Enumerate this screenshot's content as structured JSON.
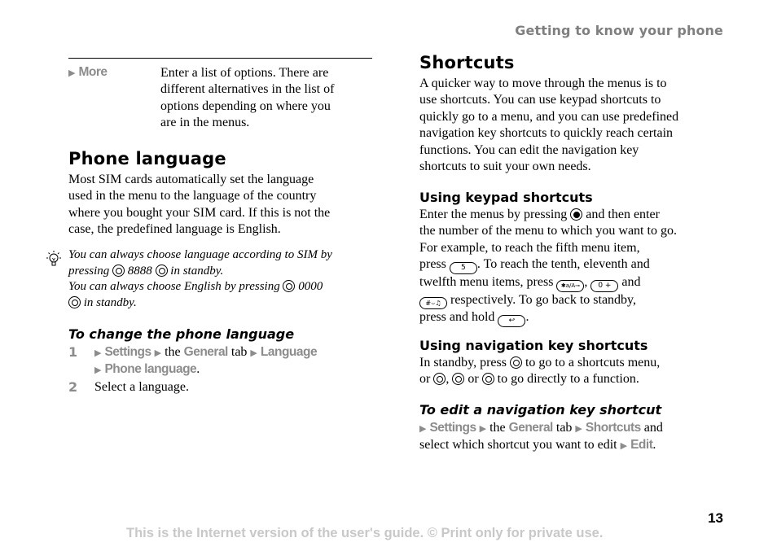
{
  "header": {
    "running_title": "Getting to know your phone"
  },
  "left": {
    "more_row": {
      "label": "More",
      "description_lines": [
        "Enter a list of options. There are",
        "different alternatives in the list of",
        "options depending on where you",
        "are in the menus."
      ]
    },
    "phone_language": {
      "title": "Phone language",
      "body_lines": [
        "Most SIM cards automatically set the language",
        "used in the menu to the language of the country",
        "where you bought your SIM card. If this is not the",
        "case, the predefined language is English."
      ]
    },
    "tip": {
      "icon": "lightbulb-icon",
      "line1": "You can always choose language according to SIM by",
      "line2_a": "pressing",
      "line2_code": "8888",
      "line2_b": "in standby.",
      "line3_a": "You can always choose English by pressing",
      "line3_code": "0000",
      "line4_b": "in standby."
    },
    "procedure": {
      "title": "To change the phone language",
      "steps": [
        {
          "num": "1",
          "settings": "Settings",
          "the": "the",
          "general": "General",
          "tab": "tab",
          "language": "Language",
          "phone_language": "Phone language",
          "end": "."
        },
        {
          "num": "2",
          "text": "Select a language."
        }
      ]
    }
  },
  "right": {
    "shortcuts": {
      "title": "Shortcuts",
      "body_lines": [
        "A quicker way to move through the menus is to",
        "use shortcuts. You can use keypad shortcuts to",
        "quickly go to a menu, and you can use predefined",
        "navigation key shortcuts to quickly reach certain",
        "functions. You can edit the navigation key",
        "shortcuts to suit your own needs."
      ]
    },
    "keypad": {
      "title": "Using keypad shortcuts",
      "l1a": "Enter the menus by pressing",
      "l1b": "and then enter",
      "l2": "the number of the menu to which you want to go.",
      "l3": "For example, to reach the fifth menu item,",
      "l4a": "press",
      "key5": "5",
      "l4b": ". To reach the tenth, eleventh and",
      "l5a": "twelfth menu items, press",
      "key_star": "✱a/A⊸",
      "l5b": ",",
      "key_zero": "0 +",
      "l5c": "and",
      "key_hash": "#⌣♫",
      "l6": "respectively. To go back to standby,",
      "l7a": "press and hold",
      "key_back": "↩",
      "l7b": "."
    },
    "navigation": {
      "title": "Using navigation key shortcuts",
      "l1a": "In standby, press",
      "l1b": "to go to a shortcuts menu,",
      "l2a": "or",
      "l2b": ",",
      "l2c": "or",
      "l2d": "to go directly to a function."
    },
    "edit": {
      "title": "To edit a navigation key shortcut",
      "settings": "Settings",
      "the": "the",
      "general": "General",
      "tab": "tab",
      "shortcuts": "Shortcuts",
      "and": "and",
      "l2": "select which shortcut you want to edit",
      "edit": "Edit",
      "end": "."
    }
  },
  "footer": {
    "notice": "This is the Internet version of the user's guide. © Print only for private use.",
    "page_number": "13"
  },
  "icons": {
    "arrow": "▶"
  }
}
